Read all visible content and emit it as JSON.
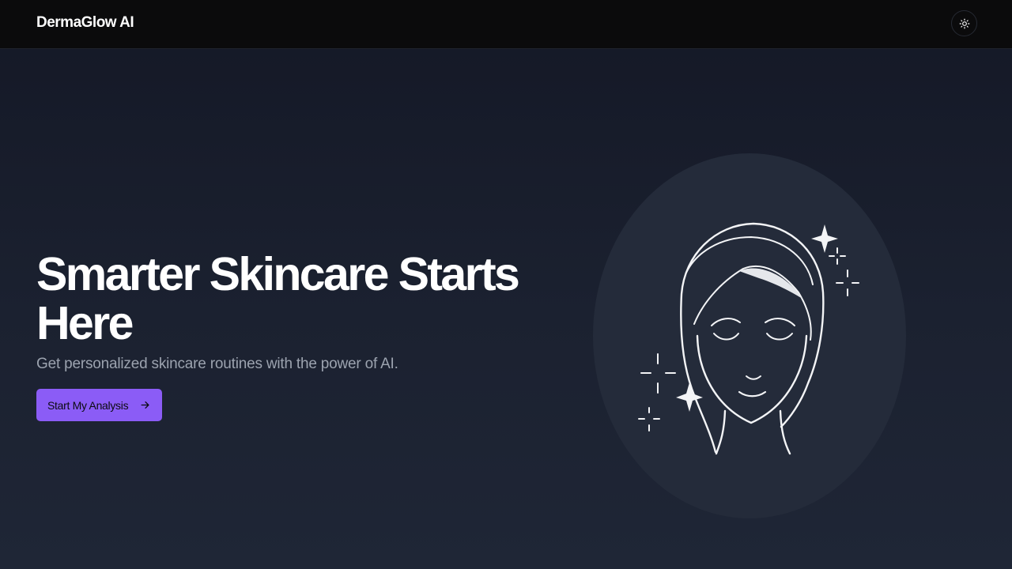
{
  "header": {
    "brand": "DermaGlow AI",
    "theme_toggle_icon": "sun-icon"
  },
  "hero": {
    "title": "Smarter Skincare Starts Here",
    "subtitle": "Get personalized skincare routines with the power of AI.",
    "cta_label": "Start My Analysis",
    "cta_icon": "arrow-right-icon",
    "illustration_icon": "face-with-sparkles-icon"
  },
  "colors": {
    "accent": "#8b5cf6",
    "navbar_bg": "#0b0b0c",
    "page_bg": "#1b2130",
    "subtitle_text": "#9ca3af",
    "illustration_bg": "#242b3a"
  }
}
